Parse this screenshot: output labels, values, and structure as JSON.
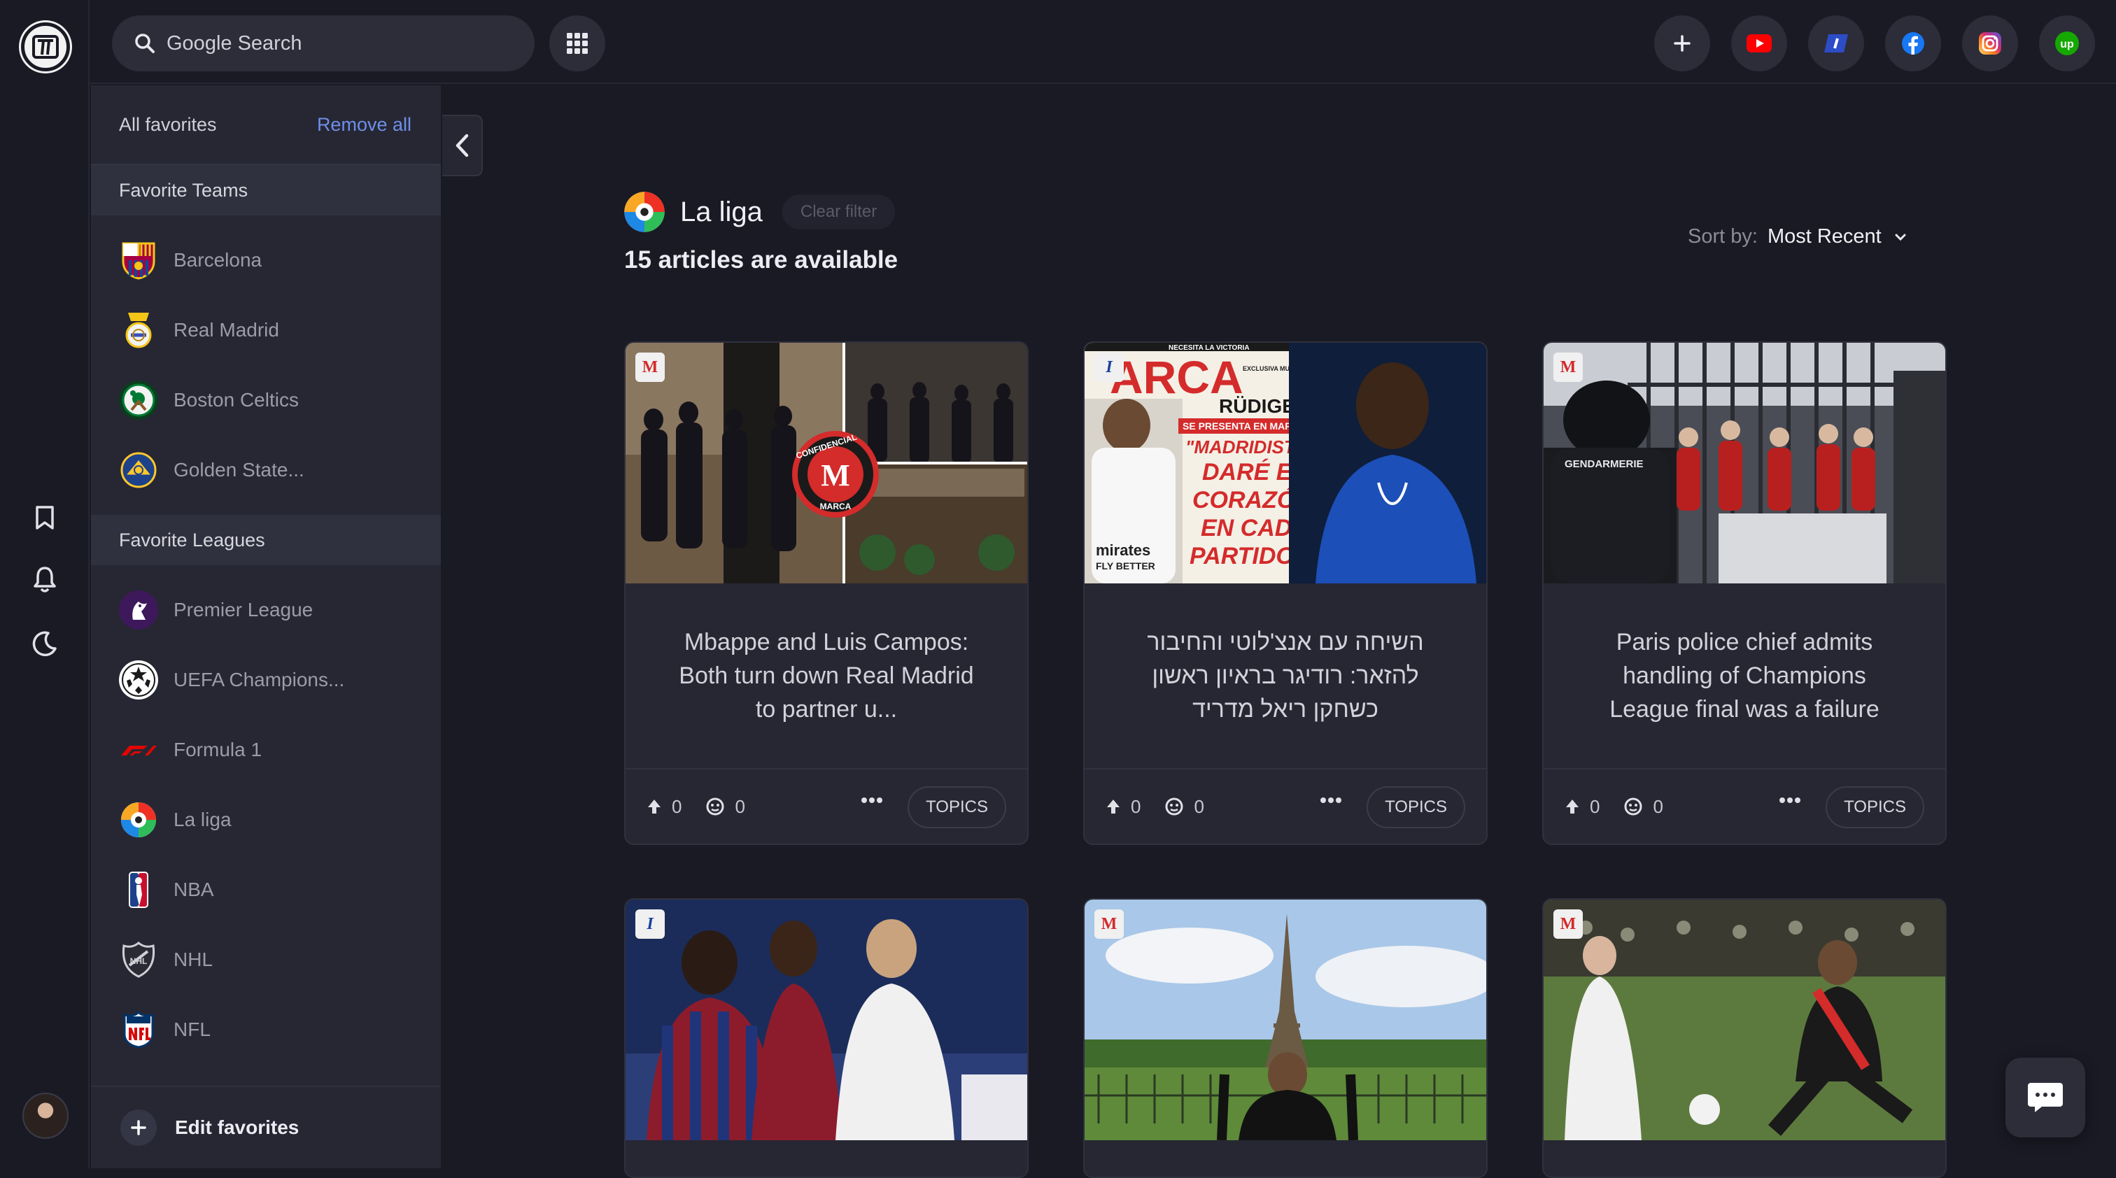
{
  "search": {
    "placeholder": "Google Search"
  },
  "topbar": {
    "buttons": [
      "add-icon",
      "youtube-icon",
      "i-app-icon",
      "facebook-icon",
      "instagram-icon",
      "upwork-icon"
    ],
    "upwork_label": "up"
  },
  "favorites": {
    "all_label": "All favorites",
    "remove_all_label": "Remove all",
    "teams_heading": "Favorite Teams",
    "teams": [
      {
        "label": "Barcelona",
        "color": "#a50044"
      },
      {
        "label": "Real Madrid",
        "color": "#f3f3f3"
      },
      {
        "label": "Boston Celtics",
        "color": "#007a33"
      },
      {
        "label": "Golden State...",
        "color": "#1d428a"
      }
    ],
    "leagues_heading": "Favorite Leagues",
    "leagues": [
      {
        "label": "Premier League",
        "color": "#3d195b"
      },
      {
        "label": "UEFA Champions...",
        "color": "#ffffff"
      },
      {
        "label": "Formula 1",
        "color": "#e10600"
      },
      {
        "label": "La liga",
        "color": "#ee3124"
      },
      {
        "label": "NBA",
        "color": "#1d428a"
      },
      {
        "label": "NHL",
        "color": "#cfcfd6"
      },
      {
        "label": "NFL",
        "color": "#013369"
      }
    ],
    "edit_label": "Edit favorites"
  },
  "filter": {
    "title": "La liga",
    "clear_label": "Clear filter",
    "count_text": "15 articles are available"
  },
  "sort": {
    "label": "Sort by:",
    "value": "Most Recent"
  },
  "articles": [
    {
      "badge": "M",
      "title": "Mbappe and Luis Campos: Both turn down Real Madrid to partner u...",
      "likes": "0",
      "comments": "0",
      "topics_label": "TOPICS"
    },
    {
      "badge": "I",
      "title": "השיחה עם אנצ'לוטי והחיבור להזאר: רודיגר בראיון ראשון כשחקן ריאל מדריד",
      "likes": "0",
      "comments": "0",
      "topics_label": "TOPICS"
    },
    {
      "badge": "M",
      "title": "Paris police chief admits handling of Champions League final was a failure",
      "likes": "0",
      "comments": "0",
      "topics_label": "TOPICS"
    },
    {
      "badge": "I"
    },
    {
      "badge": "M"
    },
    {
      "badge": "M"
    }
  ],
  "image_text": {
    "stamp_line1": "CONFIDENCIAL",
    "stamp_letter": "M",
    "stamp_line2": "MARCA",
    "marca_header": "NECESITA LA VICTORIA",
    "marca_title": "ARCA",
    "marca_exclusive": "EXCLUSIVA MUNDIAL",
    "marca_rudiger": "RÜDIGER",
    "marca_presenta": "SE PRESENTA EN MARCA",
    "marca_q1": "\"MADRIDISTAS,",
    "marca_q2": "DARÉ EL",
    "marca_q3": "CORAZÓN",
    "marca_q4": "EN CADA",
    "marca_q5": "PARTIDO\"",
    "marca_shirt": "mirates",
    "marca_shirt2": "FLY BETTER",
    "gendarmerie": "GENDARMERIE"
  },
  "colors": {
    "accent": "#6e8ee8",
    "background": "#191a24",
    "panel": "#262733"
  }
}
